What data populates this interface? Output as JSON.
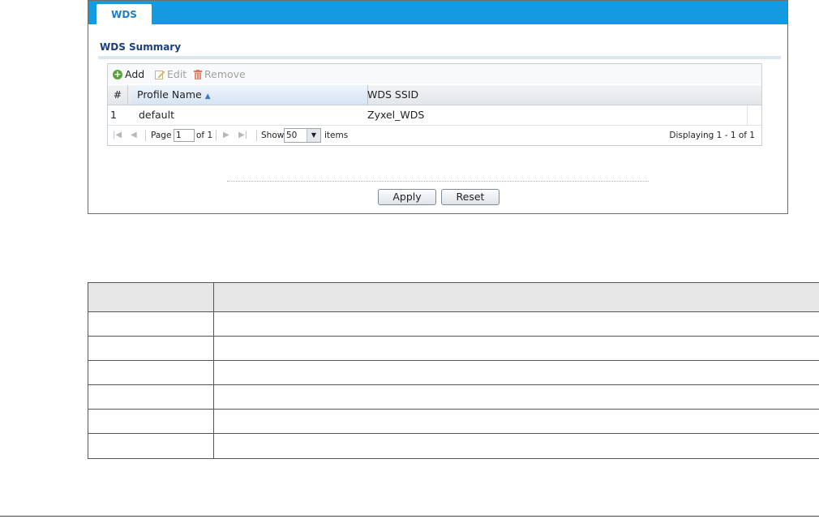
{
  "panel": {
    "tab_label": "WDS",
    "section_title": "WDS Summary",
    "toolbar": {
      "add": "Add",
      "edit": "Edit",
      "remove": "Remove"
    },
    "columns": {
      "num": "#",
      "profile": "Profile Name",
      "ssid": "WDS SSID"
    },
    "rows": [
      {
        "num": "1",
        "profile": "default",
        "ssid": "Zyxel_WDS"
      }
    ],
    "pager": {
      "page_label": "Page",
      "page_value": "1",
      "of_label": "of 1",
      "show_label": "Show",
      "show_value": "50",
      "items_label": "items",
      "displaying": "Displaying 1 - 1 of 1"
    },
    "buttons": {
      "apply": "Apply",
      "reset": "Reset"
    }
  },
  "colors": {
    "tabbar": "#149adf",
    "title": "#1a3f7d",
    "accent": "#3a78c8"
  }
}
